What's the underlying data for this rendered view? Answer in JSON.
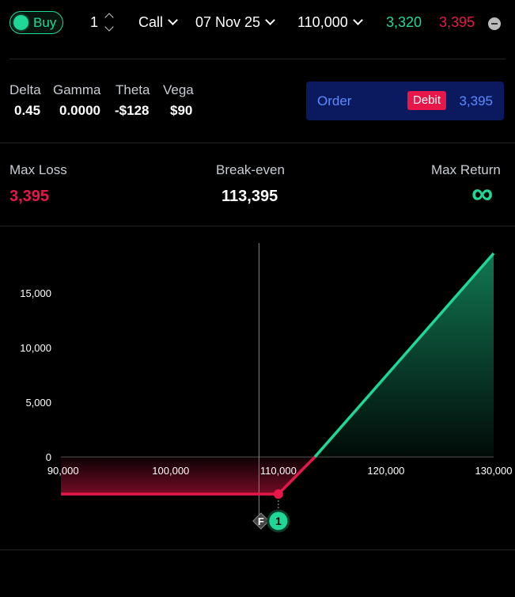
{
  "toolbar": {
    "side": "Buy",
    "quantity": "1",
    "option_type": "Call",
    "expiry": "07 Nov 25",
    "strike": "110,000",
    "bid": "3,320",
    "ask": "3,395"
  },
  "greeks": {
    "delta_label": "Delta",
    "delta": "0.45",
    "gamma_label": "Gamma",
    "gamma": "0.0000",
    "theta_label": "Theta",
    "theta": "-$128",
    "vega_label": "Vega",
    "vega": "$90"
  },
  "order": {
    "label": "Order",
    "badge": "Debit",
    "amount": "3,395"
  },
  "stats": {
    "max_loss_label": "Max Loss",
    "max_loss": "3,395",
    "breakeven_label": "Break-even",
    "breakeven": "113,395",
    "max_return_label": "Max Return",
    "max_return": "∞"
  },
  "colors": {
    "green": "#1fd897",
    "red": "#e8174a",
    "blue": "#5b8cff",
    "order_bg": "#0b1a5e"
  },
  "chart_data": {
    "type": "line",
    "x_ticks": [
      90000,
      100000,
      110000,
      120000,
      130000
    ],
    "x_tick_labels": [
      "90,000",
      "100,000",
      "110,000",
      "120,000",
      "130,000"
    ],
    "y_ticks": [
      0,
      5000,
      10000,
      15000
    ],
    "y_tick_labels": [
      "0",
      "5,000",
      "10,000",
      "15,000"
    ],
    "xlim": [
      89800,
      130000
    ],
    "ylim": [
      -3395,
      18600
    ],
    "series": [
      {
        "values": [
          [
            89800,
            -3395
          ],
          [
            110000,
            -3395
          ],
          [
            113395,
            0
          ],
          [
            130000,
            18600
          ]
        ]
      }
    ],
    "strike": 110000,
    "breakeven": 113395,
    "current_price": 108200,
    "markers": [
      {
        "label": "F",
        "shape": "diamond-icon"
      },
      {
        "label": "1",
        "shape": "circle"
      }
    ]
  }
}
